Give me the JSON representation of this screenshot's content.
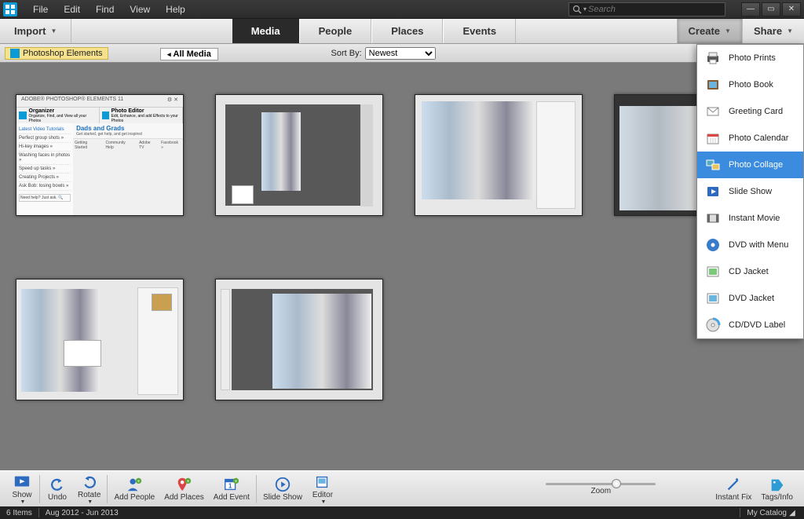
{
  "menubar": {
    "items": [
      "File",
      "Edit",
      "Find",
      "View",
      "Help"
    ]
  },
  "search": {
    "placeholder": "Search"
  },
  "toolbar": {
    "import": "Import",
    "tabs": [
      "Media",
      "People",
      "Places",
      "Events"
    ],
    "active_tab": "Media",
    "create": "Create",
    "share": "Share"
  },
  "filterbar": {
    "title": "Photoshop Elements",
    "all_media": "All Media",
    "sort_label": "Sort By:",
    "sort_value": "Newest"
  },
  "thumb1": {
    "header": "ADOBE® PHOTOSHOP® ELEMENTS 11",
    "organizer": "Organizer",
    "organizer_sub": "Organize, Find, and View all your Photos",
    "editor": "Photo Editor",
    "editor_sub": "Edit, Enhance, and add Effects to your Photos",
    "tutorials": "Latest Video Tutorials",
    "headline": "Dads and Grads",
    "headline_sub": "Get started, get help, and get inspired",
    "side_items": [
      "Perfect group shots »",
      "Hi-key images »",
      "Washing faces in photos »",
      "Speed up tasks »",
      "Creating Projects »",
      "Ask Bob: losing bowls »"
    ],
    "help_btn": "Need help? Just ask.",
    "footer": [
      "Getting Started",
      "Community Help",
      "Adobe TV",
      "Facebook »"
    ]
  },
  "create_menu": {
    "items": [
      "Photo Prints",
      "Photo Book",
      "Greeting Card",
      "Photo Calendar",
      "Photo Collage",
      "Slide Show",
      "Instant Movie",
      "DVD with Menu",
      "CD Jacket",
      "DVD Jacket",
      "CD/DVD Label"
    ],
    "selected": "Photo Collage"
  },
  "bottombar": {
    "show": "Show",
    "undo": "Undo",
    "rotate": "Rotate",
    "add_people": "Add People",
    "add_places": "Add Places",
    "add_event": "Add Event",
    "slide_show": "Slide Show",
    "editor": "Editor",
    "zoom": "Zoom",
    "instant_fix": "Instant Fix",
    "tags_info": "Tags/Info"
  },
  "statusbar": {
    "count": "6 Items",
    "date_range": "Aug 2012 - Jun 2013",
    "catalog": "My Catalog"
  }
}
